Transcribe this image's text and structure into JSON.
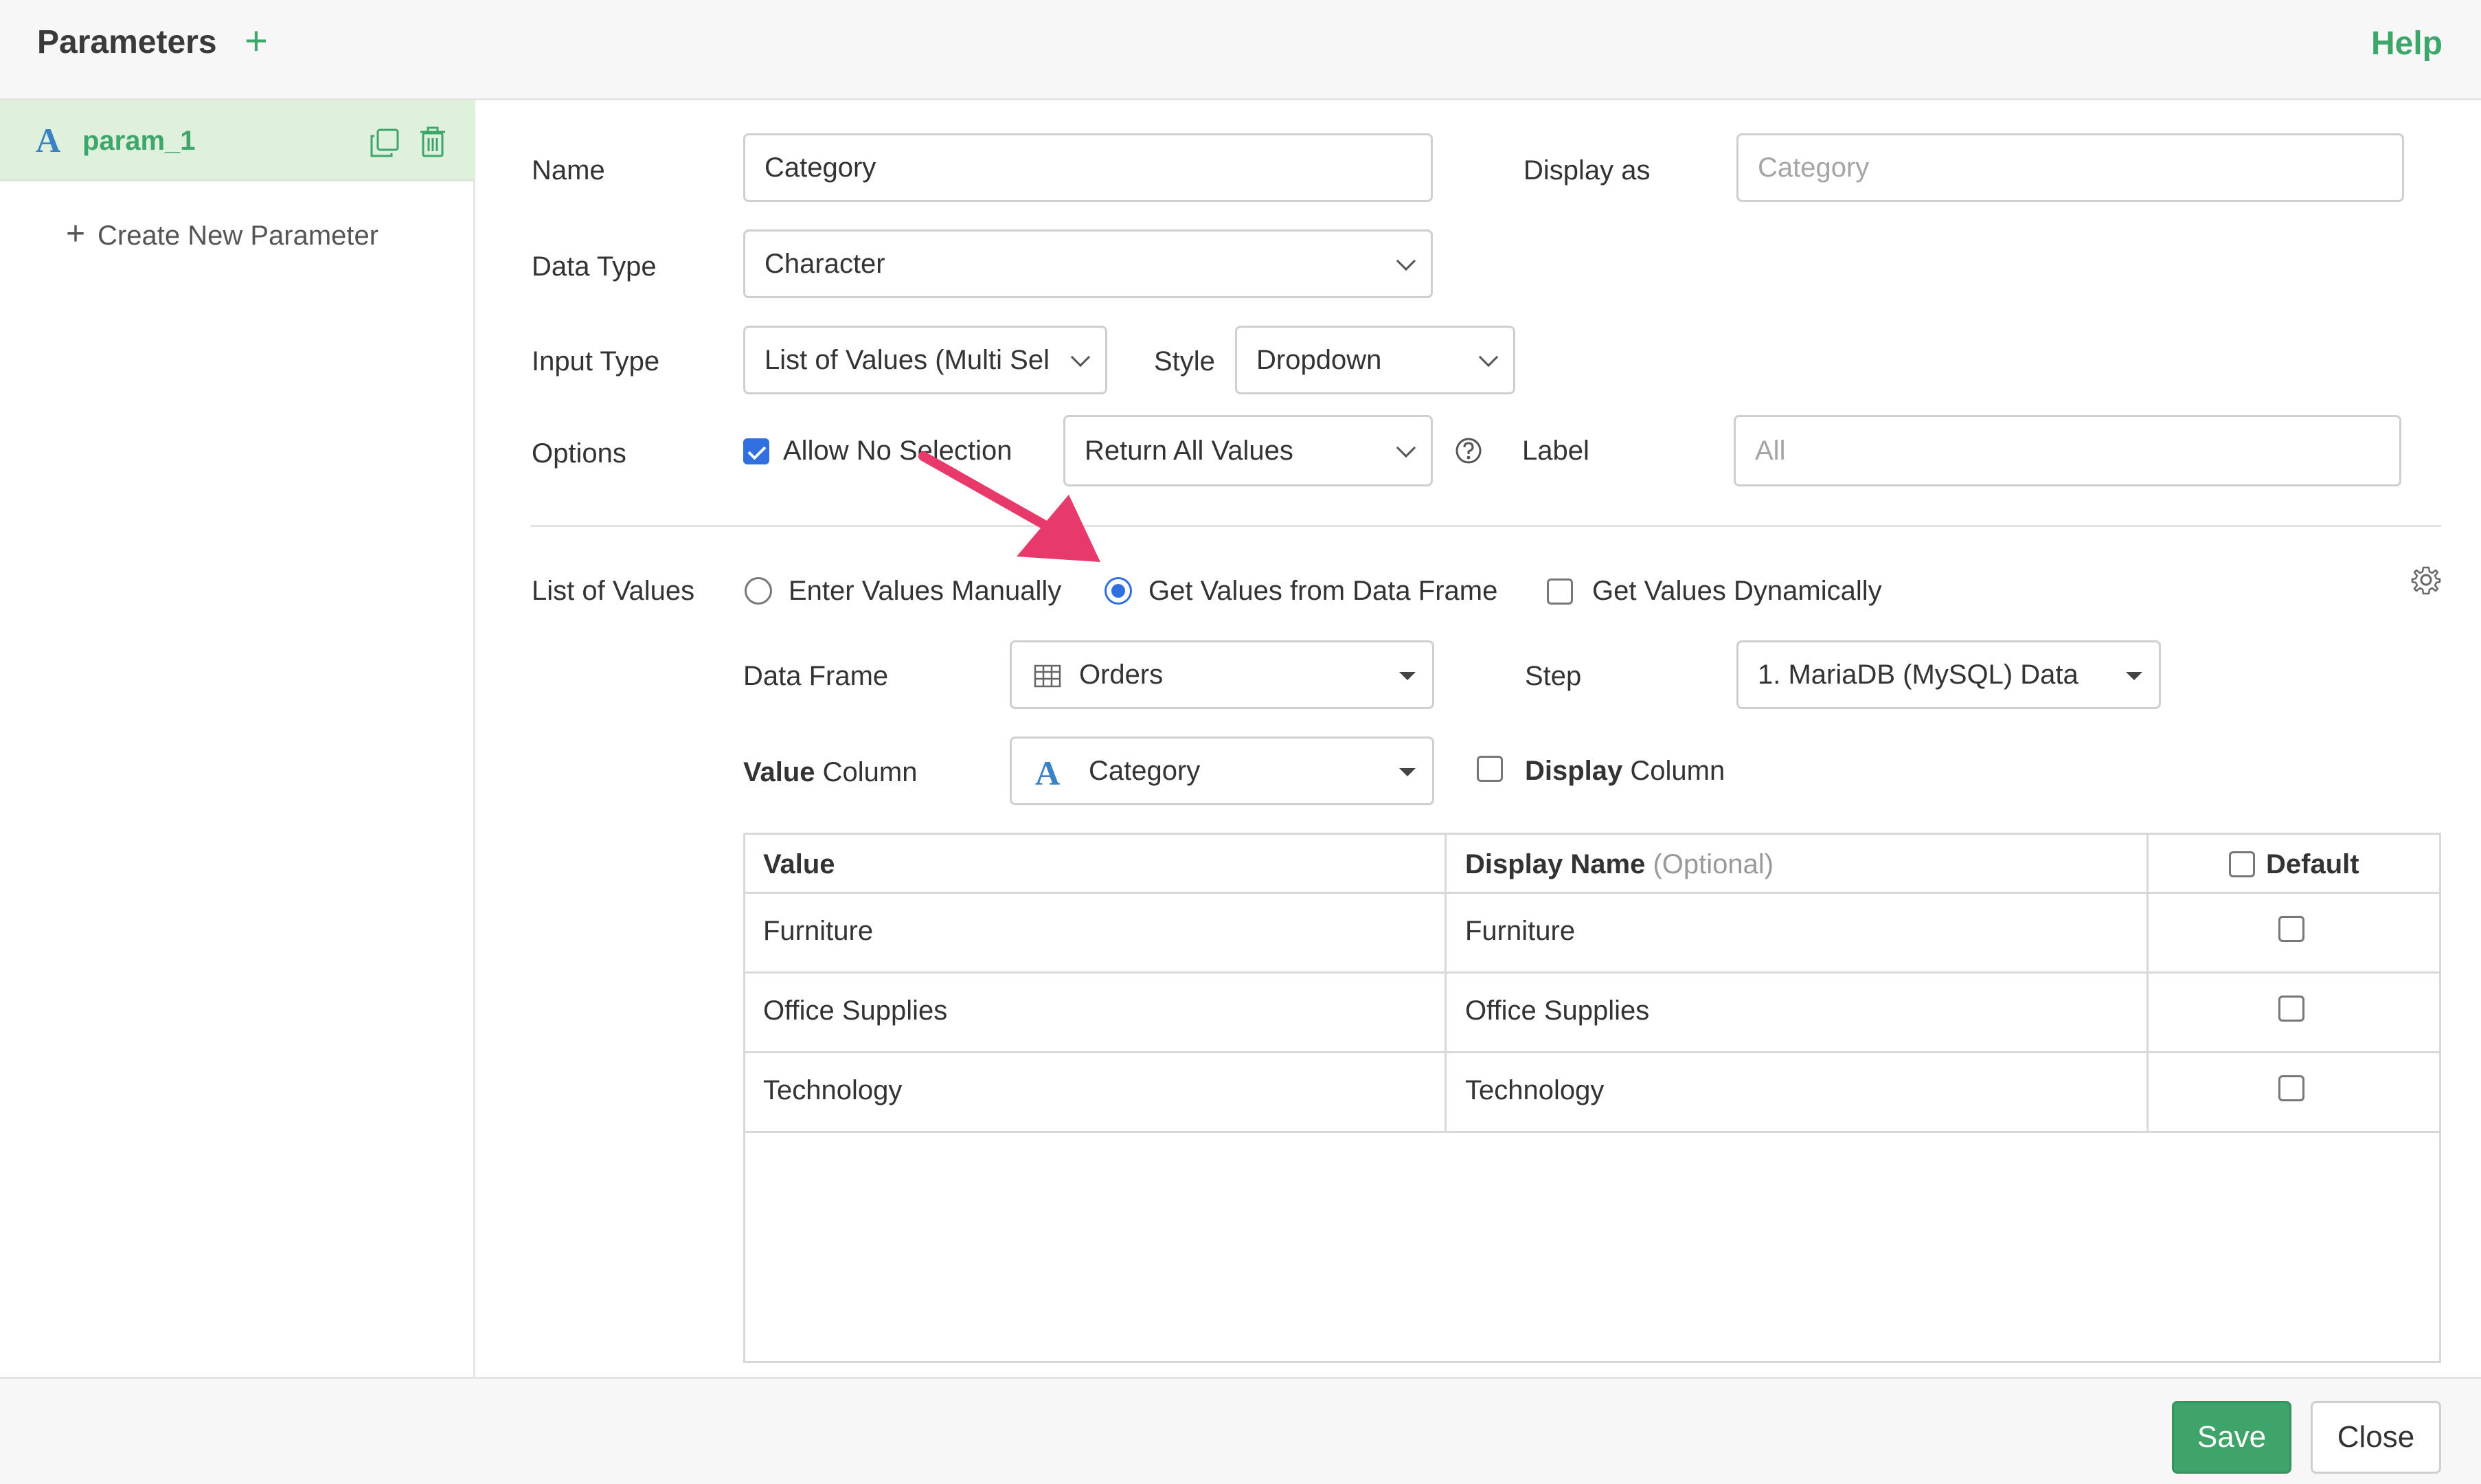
{
  "header": {
    "title": "Parameters",
    "add_icon": "plus-icon",
    "help": "Help"
  },
  "sidebar": {
    "params": [
      {
        "type_icon": "character-type-icon",
        "type_glyph": "A",
        "name": "param_1"
      }
    ],
    "create_new": "Create New Parameter"
  },
  "form": {
    "name_label": "Name",
    "name_value": "Category",
    "display_as_label": "Display as",
    "display_as_placeholder": "Category",
    "data_type_label": "Data Type",
    "data_type_value": "Character",
    "input_type_label": "Input Type",
    "input_type_value": "List of Values (Multi Sel",
    "style_label": "Style",
    "style_value": "Dropdown",
    "options_label": "Options",
    "allow_no_selection": "Allow No Selection",
    "allow_no_selection_checked": true,
    "no_selection_value": "Return All Values",
    "label_label": "Label",
    "label_placeholder": "All",
    "list_of_values_label": "List of Values",
    "lov_options": {
      "manual": "Enter Values Manually",
      "data_frame": "Get Values from Data Frame",
      "dynamic": "Get Values Dynamically",
      "selected": "data_frame"
    },
    "data_frame_label": "Data Frame",
    "data_frame_value": "Orders",
    "step_label": "Step",
    "step_value": "1. MariaDB (MySQL) Data",
    "value_column_label_bold": "Value",
    "value_column_label_rest": " Column",
    "value_column_value": "Category",
    "display_column_label_bold": "Display",
    "display_column_label_rest": " Column"
  },
  "table": {
    "headers": {
      "value": "Value",
      "display_name": "Display Name",
      "display_name_hint": "(Optional)",
      "default": "Default"
    },
    "rows": [
      {
        "value": "Furniture",
        "display": "Furniture",
        "default": false
      },
      {
        "value": "Office Supplies",
        "display": "Office Supplies",
        "default": false
      },
      {
        "value": "Technology",
        "display": "Technology",
        "default": false
      }
    ]
  },
  "footer": {
    "save": "Save",
    "close": "Close"
  },
  "colors": {
    "accent_green": "#3da66a",
    "selected_blue": "#2f6fe0",
    "annotation_arrow": "#e8396b"
  }
}
